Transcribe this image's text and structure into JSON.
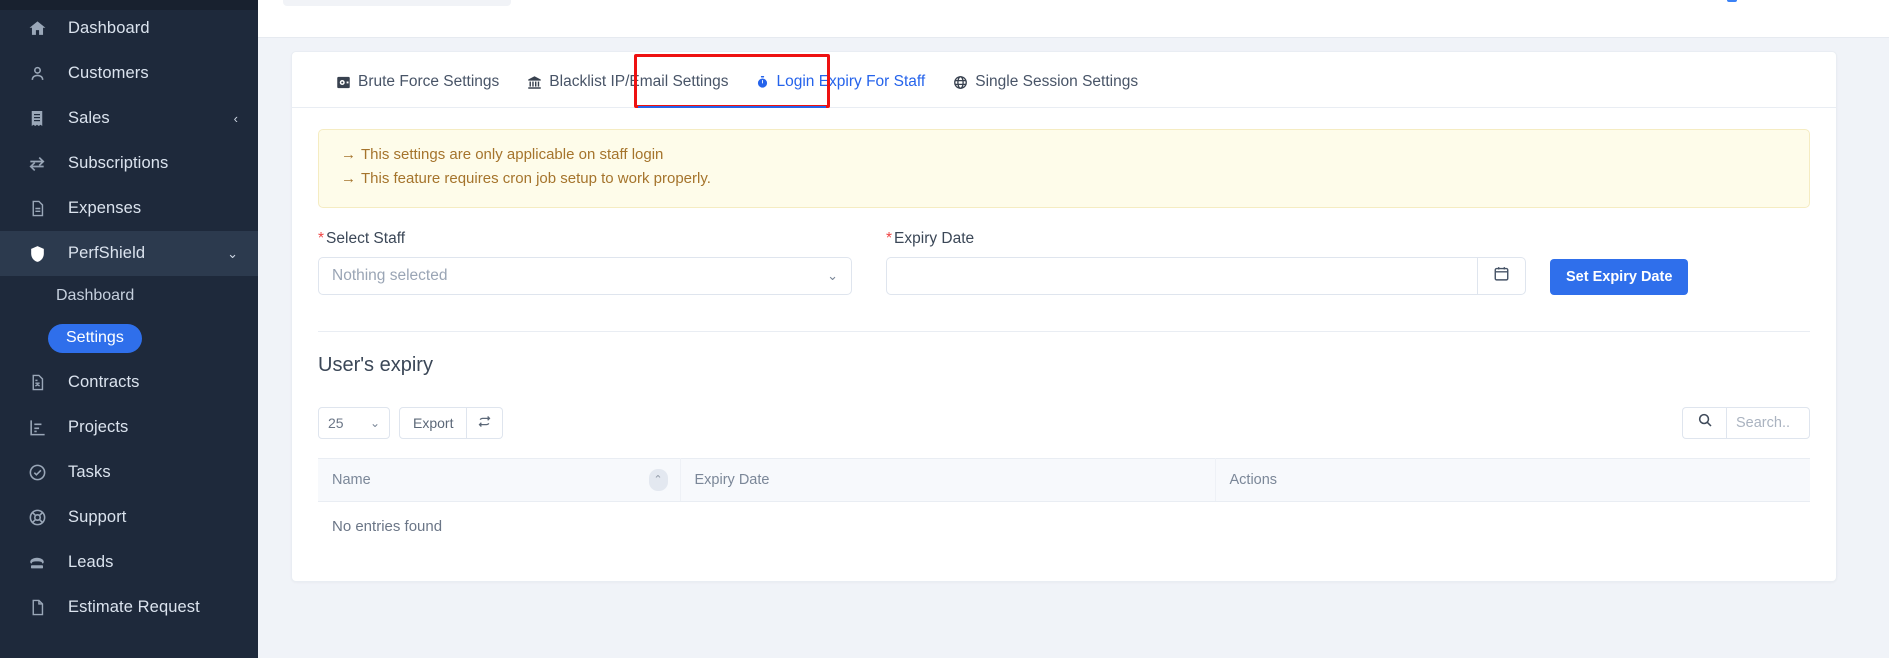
{
  "sidebar": {
    "items": [
      {
        "label": "Dashboard",
        "icon": "home-icon",
        "active": false
      },
      {
        "label": "Customers",
        "icon": "user-icon",
        "active": false
      },
      {
        "label": "Sales",
        "icon": "receipt-icon",
        "active": false,
        "chevron": "‹"
      },
      {
        "label": "Subscriptions",
        "icon": "sync-icon",
        "active": false
      },
      {
        "label": "Expenses",
        "icon": "document-icon",
        "active": false
      },
      {
        "label": "PerfShield",
        "icon": "shield-icon",
        "active": true,
        "chevron": "⌄"
      },
      {
        "label": "Contracts",
        "icon": "contract-icon",
        "active": false
      },
      {
        "label": "Projects",
        "icon": "chart-icon",
        "active": false
      },
      {
        "label": "Tasks",
        "icon": "check-circle-icon",
        "active": false
      },
      {
        "label": "Support",
        "icon": "lifebuoy-icon",
        "active": false
      },
      {
        "label": "Leads",
        "icon": "phone-icon",
        "active": false
      },
      {
        "label": "Estimate Request",
        "icon": "file-icon",
        "active": false
      }
    ],
    "sub_items": [
      {
        "label": "Dashboard",
        "active": false
      },
      {
        "label": "Settings",
        "active": true
      }
    ]
  },
  "tabs": [
    {
      "label": "Brute Force Settings",
      "icon": "vault-icon",
      "active": false
    },
    {
      "label": "Blacklist IP/Email Settings",
      "icon": "bank-icon",
      "active": false
    },
    {
      "label": "Login Expiry For Staff",
      "icon": "stopwatch-icon",
      "active": true
    },
    {
      "label": "Single Session Settings",
      "icon": "globe-icon",
      "active": false
    }
  ],
  "alert": {
    "arrow": "→",
    "line1": "This settings are only applicable on staff login",
    "line2": "This feature requires cron job setup to work properly."
  },
  "form": {
    "select_staff_label": "Select Staff",
    "select_staff_value": "Nothing selected",
    "select_chevron": "⌄",
    "expiry_date_label": "Expiry Date",
    "expiry_date_value": "",
    "expiry_date_placeholder": "",
    "set_expiry_button": "Set Expiry Date",
    "required_mark": "*"
  },
  "table_section": {
    "title": "User's expiry",
    "page_length": "25",
    "page_length_chevron": "⌄",
    "export_label": "Export",
    "refresh_icon": "refresh-icon",
    "search_placeholder": "Search..",
    "search_value": "",
    "columns": [
      {
        "label": "Name",
        "sorted": true,
        "sort_caret": "⌃"
      },
      {
        "label": "Expiry Date",
        "sorted": false
      },
      {
        "label": "Actions",
        "sorted": false
      }
    ],
    "rows": [],
    "empty_message": "No entries found"
  },
  "colors": {
    "accent": "#2f6feb",
    "tab_active": "#2563eb",
    "highlight_box": "#ee1111",
    "sidebar_bg": "#1e293b",
    "alert_bg": "#fefcea",
    "alert_text": "#a5742c"
  }
}
